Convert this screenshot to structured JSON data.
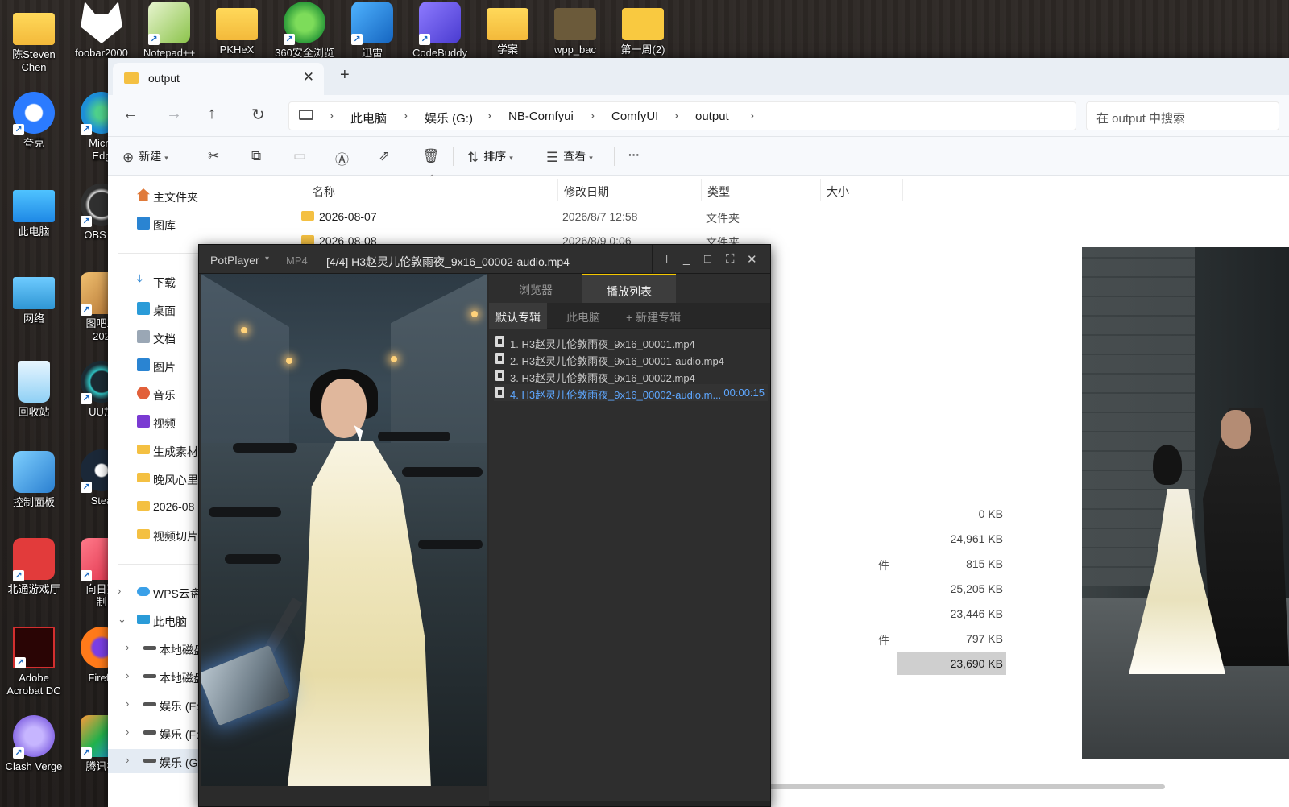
{
  "desktop": {
    "icons_col1": [
      {
        "label": "陈Steven\nChen",
        "icon": "user-folder-icon",
        "color": "#f3b93a"
      },
      {
        "label": "夸克",
        "icon": "quark-browser-icon",
        "color": "#2b7bff"
      },
      {
        "label": "此电脑",
        "icon": "this-pc-icon",
        "color": "#29a7e6"
      },
      {
        "label": "网络",
        "icon": "network-icon",
        "color": "#2f96d4"
      },
      {
        "label": "回收站",
        "icon": "recycle-bin-icon",
        "color": "#5fb5e8"
      },
      {
        "label": "控制面板",
        "icon": "control-panel-icon",
        "color": "#3a8fd8"
      },
      {
        "label": "北通游戏厅",
        "icon": "game-hall-icon",
        "color": "#e23b3b"
      },
      {
        "label": "Adobe\nAcrobat DC",
        "icon": "acrobat-icon",
        "color": "#2a0505"
      },
      {
        "label": "Clash Verge",
        "icon": "clash-verge-icon",
        "color": "#9b7cf0"
      }
    ],
    "icons_col2": [
      {
        "label": "Micro\nEdg",
        "icon": "edge-icon",
        "color": "#1d8fd8"
      },
      {
        "label": "OBS St",
        "icon": "obs-icon",
        "color": "#303030"
      },
      {
        "label": "图吧工\n202",
        "icon": "toolbox-icon",
        "color": "#d89a3a"
      },
      {
        "label": "UU加",
        "icon": "uu-accelerator-icon",
        "color": "#2fc2c2"
      },
      {
        "label": "Stea",
        "icon": "steam-icon",
        "color": "#1b2838"
      },
      {
        "label": "向日葵\n制",
        "icon": "sunlogin-icon",
        "color": "#ef4a5c"
      },
      {
        "label": "Firefo",
        "icon": "firefox-icon",
        "color": "#ff7a1a"
      },
      {
        "label": "腾讯视",
        "icon": "tencent-video-icon",
        "color": "#22b24c"
      }
    ],
    "icons_top": [
      {
        "label": "foobar2000",
        "icon": "foobar-icon",
        "color": "#ffffff"
      },
      {
        "label": "Notepad++",
        "icon": "notepad-plus-icon",
        "color": "#8bc34a"
      },
      {
        "label": "PKHeX",
        "icon": "pkhex-folder-icon",
        "color": "#f3b93a"
      },
      {
        "label": "360安全浏览",
        "icon": "360-browser-icon",
        "color": "#3cb44a"
      },
      {
        "label": "迅雷",
        "icon": "xunlei-icon",
        "color": "#1e88e5"
      },
      {
        "label": "CodeBuddy",
        "icon": "codebuddy-icon",
        "color": "#6c5ce7"
      },
      {
        "label": "学案",
        "icon": "folder-icon",
        "color": "#f3b93a"
      },
      {
        "label": "wpp_bac",
        "icon": "dark-folder-icon",
        "color": "#6b5a3a"
      },
      {
        "label": "第一周(2)",
        "icon": "folder-icon",
        "color": "#f9c940"
      }
    ]
  },
  "explorer": {
    "tab_title": "output",
    "new_tab": "+",
    "breadcrumb": [
      "此电脑",
      "娱乐 (G:)",
      "NB-Comfyui",
      "ComfyUI",
      "output"
    ],
    "search_placeholder": "在 output 中搜索",
    "toolbar": {
      "new_label": "新建",
      "sort_label": "排序",
      "view_label": "查看",
      "more_label": "···"
    },
    "sidebar": {
      "home": "主文件夹",
      "gallery": "图库",
      "downloads": "下载",
      "desktop": "桌面",
      "documents": "文档",
      "pictures": "图片",
      "music": "音乐",
      "videos": "视频",
      "pinned1": "生成素材",
      "pinned2": "晚风心里",
      "pinned3": "2026-08",
      "pinned4": "视频切片",
      "wps": "WPS云盘",
      "thispc": "此电脑",
      "drive1": "本地磁盘",
      "drive2": "本地磁盘",
      "drive3": "娱乐 (E:",
      "drive4": "娱乐 (F:",
      "drive5": "娱乐 (G:"
    },
    "columns": {
      "name": "名称",
      "date": "修改日期",
      "type": "类型",
      "size": "大小"
    },
    "rows": [
      {
        "name": "2026-08-07",
        "date": "2026/8/7 12:58",
        "type": "文件夹"
      },
      {
        "name": "2026-08-08",
        "date": "2026/8/9 0:06",
        "type": "文件夹"
      }
    ],
    "sizes": [
      "0 KB",
      "24,961 KB",
      "815 KB",
      "25,205 KB",
      "23,446 KB",
      "797 KB",
      "23,690 KB"
    ],
    "type_fragment": "件"
  },
  "potplayer": {
    "app_name": "PotPlayer",
    "format": "MP4",
    "title": "[4/4] H3赵灵儿伦敦雨夜_9x16_00002-audio.mp4",
    "tabs": {
      "browser": "浏览器",
      "playlist": "播放列表"
    },
    "subtabs": {
      "default": "默认专辑",
      "pc": "此电脑",
      "new": "+ 新建专辑"
    },
    "playlist": [
      {
        "text": "1. H3赵灵儿伦敦雨夜_9x16_00001.mp4",
        "duration": ""
      },
      {
        "text": "2. H3赵灵儿伦敦雨夜_9x16_00001-audio.mp4",
        "duration": ""
      },
      {
        "text": "3. H3赵灵儿伦敦雨夜_9x16_00002.mp4",
        "duration": ""
      },
      {
        "text": "4. H3赵灵儿伦敦雨夜_9x16_00002-audio.m...",
        "duration": "00:00:15"
      }
    ],
    "accent": "#f4c700",
    "current_color": "#5ea7ff"
  }
}
